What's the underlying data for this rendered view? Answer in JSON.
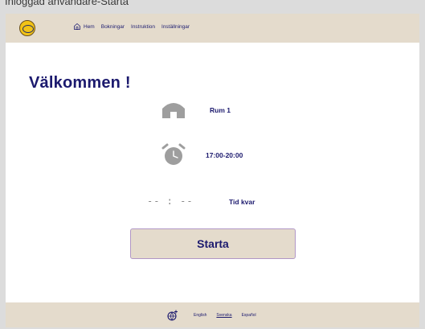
{
  "window": {
    "title": "Inloggad användare-Starta"
  },
  "navbar": {
    "logo": "hsb-logo",
    "items": [
      {
        "label": "Hem",
        "icon": "home-icon"
      },
      {
        "label": "Bokningar"
      },
      {
        "label": "Instruktion"
      },
      {
        "label": "Inställningar"
      }
    ]
  },
  "main": {
    "heading": "Välkommen !",
    "room": {
      "icon": "house-icon",
      "label": "Rum 1"
    },
    "time": {
      "icon": "alarm-clock-icon",
      "label": "17:00-20:00"
    },
    "timer": {
      "display": "-- : --",
      "label": "Tid kvar"
    },
    "start_button": "Starta"
  },
  "footer": {
    "languages": [
      "English",
      "Svenska",
      "Español"
    ],
    "active_language": "Svenska"
  },
  "colors": {
    "bar_background": "#e4dbcc",
    "text_navy": "#1c1a6e",
    "icon_gray": "#9e9e9e",
    "button_border": "#b197c6"
  }
}
